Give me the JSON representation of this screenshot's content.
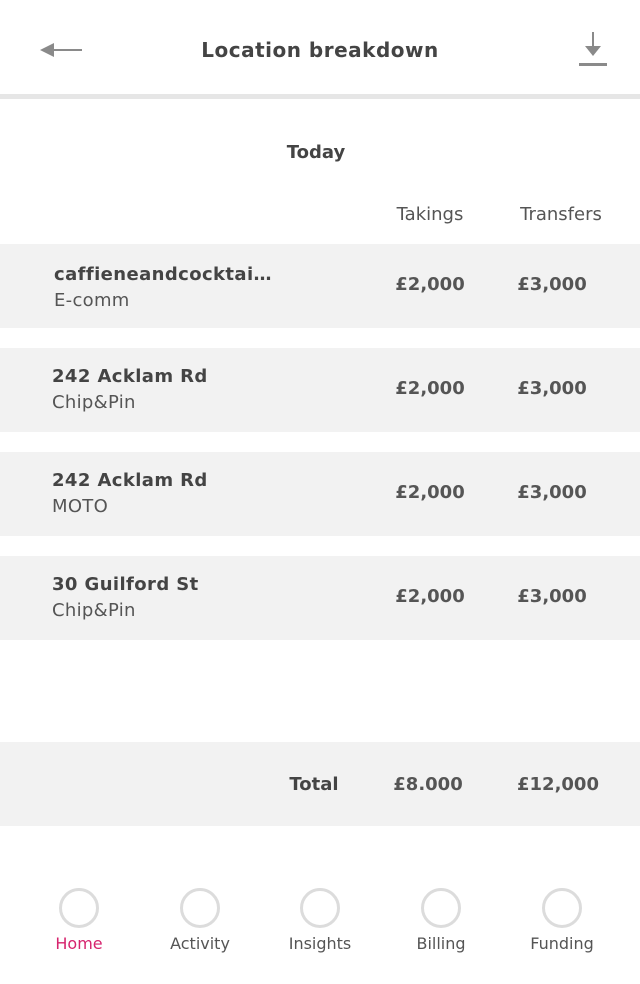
{
  "header": {
    "title": "Location breakdown",
    "back_icon": "arrow-left-icon",
    "download_icon": "download-icon"
  },
  "period": "Today",
  "columns": {
    "takings": "Takings",
    "transfers": "Transfers"
  },
  "rows": [
    {
      "name": "caffieneandcocktails...",
      "type": "E-comm",
      "takings": "£2,000",
      "transfers": "£3,000"
    },
    {
      "name": "242 Acklam Rd",
      "type": "Chip&Pin",
      "takings": "£2,000",
      "transfers": "£3,000"
    },
    {
      "name": "242 Acklam Rd",
      "type": "MOTO",
      "takings": "£2,000",
      "transfers": "£3,000"
    },
    {
      "name": "30 Guilford St",
      "type": "Chip&Pin",
      "takings": "£2,000",
      "transfers": "£3,000"
    }
  ],
  "total": {
    "label": "Total",
    "takings": "£8.000",
    "transfers": "£12,000"
  },
  "nav": {
    "items": [
      {
        "label": "Home",
        "icon": "home-icon",
        "active": true
      },
      {
        "label": "Activity",
        "icon": "activity-icon",
        "active": false
      },
      {
        "label": "Insights",
        "icon": "insights-icon",
        "active": false
      },
      {
        "label": "Billing",
        "icon": "billing-icon",
        "active": false
      },
      {
        "label": "Funding",
        "icon": "funding-icon",
        "active": false
      }
    ],
    "active_color": "#d6246e"
  }
}
